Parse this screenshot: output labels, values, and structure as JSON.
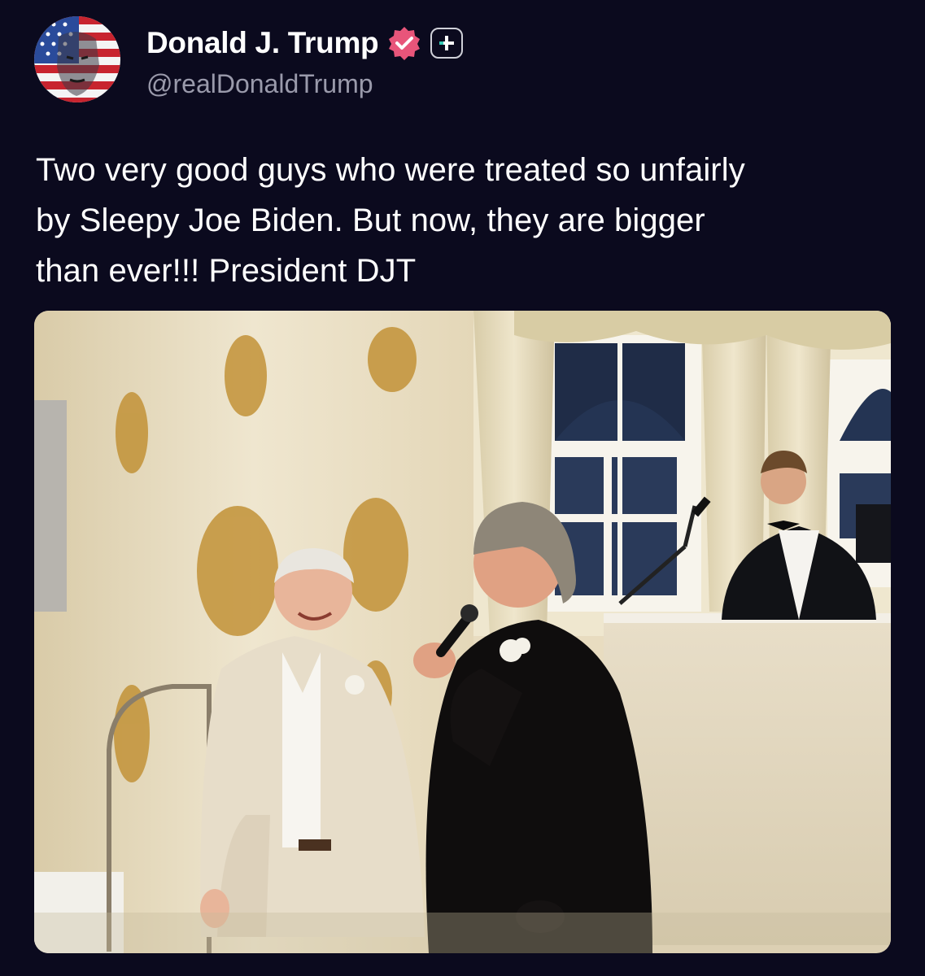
{
  "post": {
    "author": {
      "display_name": "Donald J. Trump",
      "handle": "@realDonaldTrump",
      "verified": true,
      "verified_icon": "verified-badge-icon",
      "subscription_icon": "plus-badge-icon",
      "verified_color": "#e8557a"
    },
    "text_lines": [
      "Two very good guys who were treated so unfairly",
      "by Sleepy Joe Biden. But now, they are bigger",
      "than ever!!! President DJT"
    ],
    "media": {
      "type": "photo"
    }
  },
  "theme": {
    "background": "#0b0a1e",
    "text_primary": "#ffffff",
    "text_secondary": "#9a9aab"
  }
}
